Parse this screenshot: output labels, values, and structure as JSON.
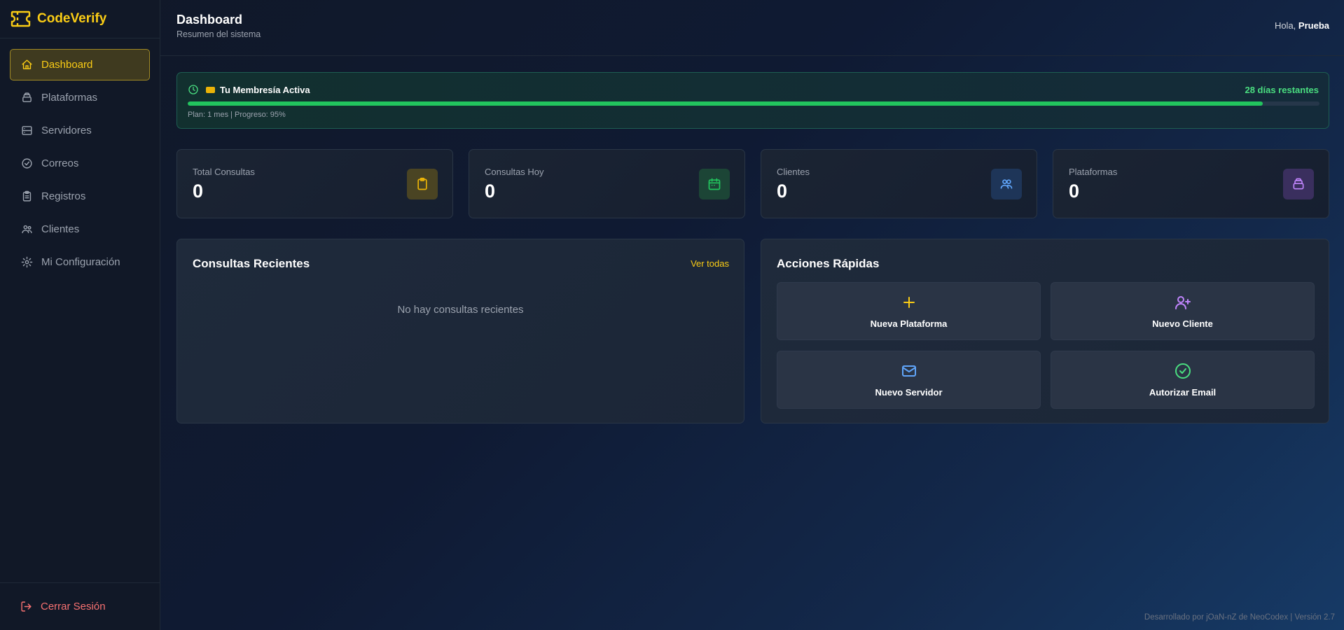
{
  "brand": {
    "name": "CodeVerify"
  },
  "sidebar": {
    "items": [
      {
        "label": "Dashboard",
        "icon": "home-icon",
        "active": true
      },
      {
        "label": "Plataformas",
        "icon": "layers-icon"
      },
      {
        "label": "Servidores",
        "icon": "server-icon"
      },
      {
        "label": "Correos",
        "icon": "check-circle-icon"
      },
      {
        "label": "Registros",
        "icon": "clipboard-icon"
      },
      {
        "label": "Clientes",
        "icon": "users-icon"
      },
      {
        "label": "Mi Configuración",
        "icon": "gear-icon"
      }
    ],
    "logout_label": "Cerrar Sesión"
  },
  "header": {
    "title": "Dashboard",
    "subtitle": "Resumen del sistema",
    "greeting_prefix": "Hola,",
    "user_name": "Prueba"
  },
  "membership": {
    "title": "Tu Membresía Activa",
    "days_remaining": "28 días restantes",
    "progress_percent": 95,
    "plan_text": "Plan: 1 mes | Progreso: 95%"
  },
  "stats": [
    {
      "label": "Total Consultas",
      "value": "0",
      "icon": "clipboard-icon",
      "color": "#eab308"
    },
    {
      "label": "Consultas Hoy",
      "value": "0",
      "icon": "calendar-icon",
      "color": "#22c55e"
    },
    {
      "label": "Clientes",
      "value": "0",
      "icon": "users-icon",
      "color": "#60a5fa"
    },
    {
      "label": "Plataformas",
      "value": "0",
      "icon": "layers-icon",
      "color": "#a78bfa"
    }
  ],
  "recent": {
    "title": "Consultas Recientes",
    "view_all": "Ver todas",
    "empty": "No hay consultas recientes"
  },
  "quick_actions": {
    "title": "Acciones Rápidas",
    "items": [
      {
        "label": "Nueva Plataforma",
        "icon": "plus-icon",
        "color": "#facc15"
      },
      {
        "label": "Nuevo Cliente",
        "icon": "user-plus-icon",
        "color": "#c084fc"
      },
      {
        "label": "Nuevo Servidor",
        "icon": "mail-icon",
        "color": "#60a5fa"
      },
      {
        "label": "Autorizar Email",
        "icon": "check-circle-icon",
        "color": "#4ade80"
      }
    ]
  },
  "footer": {
    "text": "Desarrollado por jOaN-nZ de NeoCodex | Versión 2.7"
  }
}
